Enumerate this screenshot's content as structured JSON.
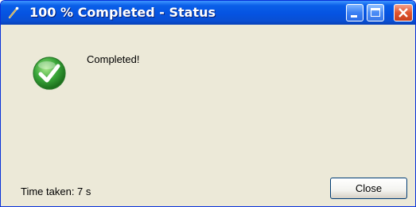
{
  "window": {
    "title": "100 % Completed - Status"
  },
  "title_buttons": {
    "minimize_icon": "minimize-icon",
    "maximize_icon": "maximize-icon",
    "close_icon": "close-icon"
  },
  "status": {
    "icon": "checkmark-icon",
    "message": "Completed!"
  },
  "footer": {
    "time_taken": "Time taken: 7 s",
    "close_label": "Close"
  },
  "colors": {
    "titlebar": "#0553e1",
    "body": "#ece9d8",
    "check_green": "#3aa63a"
  }
}
